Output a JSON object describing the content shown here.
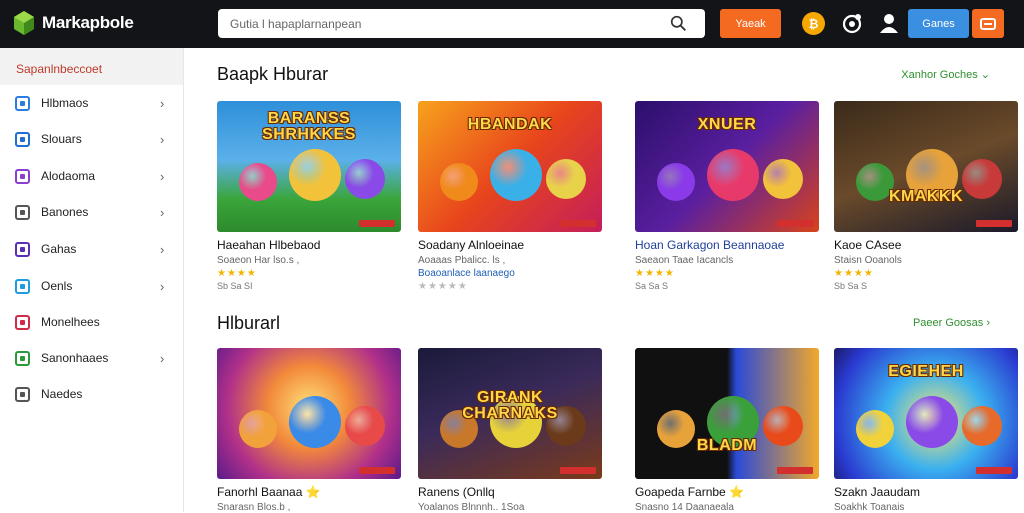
{
  "app": {
    "name": "Markapbole"
  },
  "search": {
    "placeholder": "Gutia l hapaplarnanpean"
  },
  "toolbar": {
    "orange_label": "Yaeak",
    "coin_symbol": "₿",
    "blue_label": "Ganes"
  },
  "sidebar": {
    "header": "Sapanlnbeccoet",
    "items": [
      {
        "label": "Hlbmaos",
        "icon": "tv-icon",
        "color": "#2a7de1",
        "chevron": true
      },
      {
        "label": "Slouars",
        "icon": "grid-icon",
        "color": "#1f6fd1",
        "chevron": true
      },
      {
        "label": "Alodaoma",
        "icon": "palette-icon",
        "color": "#8a3fd1",
        "chevron": true
      },
      {
        "label": "Banones",
        "icon": "doc-icon",
        "color": "#555555",
        "chevron": true
      },
      {
        "label": "Gahas",
        "icon": "controller-icon",
        "color": "#5b2fb5",
        "chevron": true
      },
      {
        "label": "Oenls",
        "icon": "circle-icon",
        "color": "#1f9be0",
        "chevron": true
      },
      {
        "label": "Monelhees",
        "icon": "tag-icon",
        "color": "#d02a4a",
        "chevron": false
      },
      {
        "label": "Sanonhaaes",
        "icon": "square-icon",
        "color": "#2a9a3a",
        "chevron": true
      },
      {
        "label": "Naedes",
        "icon": "clock-icon",
        "color": "#555555",
        "chevron": false
      }
    ]
  },
  "sections": [
    {
      "title": "Baapk Hburar",
      "see_all": "Xanhor Goches ⌄",
      "cards": [
        {
          "thumb_text": "BARANSS\nSHRHKKES",
          "title": "Haeahan Hlbebaod",
          "sub": "Soaeon Har lso.s ,",
          "stars": "★★★★",
          "meta": "Sb Sa SI"
        },
        {
          "thumb_text": "HBANDAK",
          "title": "Soadany Alnloeinae",
          "sub": "Aoaaas Pbalicc. ls ,",
          "sub2": "Boaoanlace laanaego",
          "stars": "★★★★★",
          "stars_grey": true
        },
        {
          "thumb_text": "XNUER",
          "title": "Hoan Garkagon Beannaoae",
          "sub": "Saeaon Taae Iacancls",
          "stars": "★★★★",
          "meta": "Sa Sa S"
        },
        {
          "thumb_text": "KMAKKK",
          "title": "Kaoe CAsee",
          "sub": "Staisn Ooanols",
          "stars": "★★★★",
          "meta": "Sb Sa S"
        }
      ]
    },
    {
      "title": "Hlburarl",
      "see_all": "Paeer Goosas ›",
      "cards": [
        {
          "thumb_text": "",
          "title": "Fanorhl Baanaa ⭐",
          "sub": "Snarasn Blos.b ,"
        },
        {
          "thumb_text": "GIRANK\nCHARNAKS",
          "title": "Ranens (Onllq",
          "sub": "Yoalanos Blnnnh.. 1Soa"
        },
        {
          "thumb_text": "BLADM",
          "title": "Goapeda Farnbe ⭐",
          "sub": "Snasno 14 Daanaeala"
        },
        {
          "thumb_text": "EGIEHEH",
          "title": "Szakn Jaaudam",
          "sub": "Soakhk Toanais"
        }
      ]
    }
  ],
  "colors": {
    "topbar": "#131417",
    "accent_orange": "#f46a21",
    "accent_blue": "#3b8fe0",
    "link_green": "#2f8f2f",
    "sidebar_header_red": "#c0392b"
  }
}
